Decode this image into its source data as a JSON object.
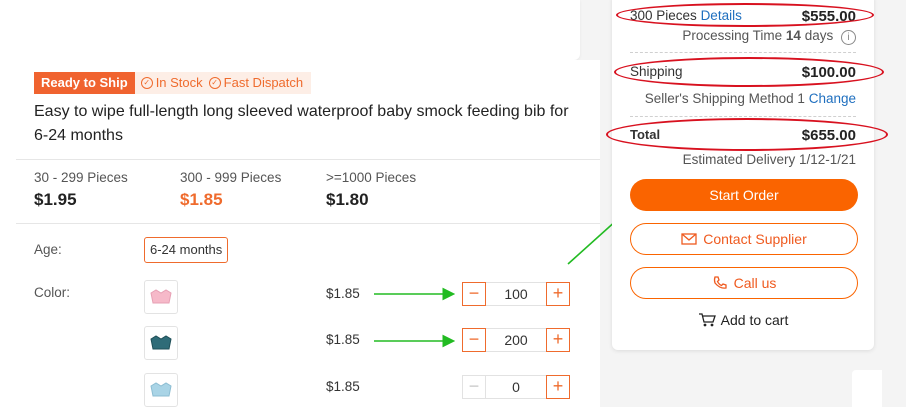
{
  "badges": {
    "ready": "Ready to Ship",
    "in_stock": "In Stock",
    "fast_dispatch": "Fast Dispatch"
  },
  "product": {
    "title": "Easy to wipe full-length long sleeved waterproof baby smock feeding bib for 6-24 months"
  },
  "tiers": [
    {
      "qty": "30 - 299 Pieces",
      "price": "$1.95",
      "highlight": false
    },
    {
      "qty": "300 - 999 Pieces",
      "price": "$1.85",
      "highlight": true
    },
    {
      "qty": ">=1000 Pieces",
      "price": "$1.80",
      "highlight": false
    }
  ],
  "age": {
    "label": "Age:",
    "selected": "6-24 months"
  },
  "color": {
    "label": "Color:",
    "rows": [
      {
        "price": "$1.85",
        "qty": "100",
        "swatch": "pink",
        "color": "#f6b9c9"
      },
      {
        "price": "$1.85",
        "qty": "200",
        "swatch": "teal",
        "color": "#2f6c78"
      },
      {
        "price": "$1.85",
        "qty": "0",
        "swatch": "light-blue",
        "color": "#a9d4e6"
      }
    ]
  },
  "summary": {
    "pieces": "300 Pieces",
    "details": "Details",
    "pieces_price": "$555.00",
    "processing_prefix": "Processing Time",
    "processing_days": "14",
    "processing_suffix": "days",
    "shipping_label": "Shipping",
    "shipping_price": "$100.00",
    "method_text": "Seller's Shipping Method 1",
    "change": "Change",
    "total_label": "Total",
    "total_price": "$655.00",
    "delivery": "Estimated Delivery 1/12-1/21"
  },
  "actions": {
    "start_order": "Start Order",
    "contact_supplier": "Contact Supplier",
    "call_us": "Call us",
    "add_to_cart": "Add to cart"
  },
  "colors": {
    "accent": "#fa6400",
    "annotation_red": "#d8111f",
    "annotation_green": "#22bb22",
    "link": "#1f6fbf"
  }
}
